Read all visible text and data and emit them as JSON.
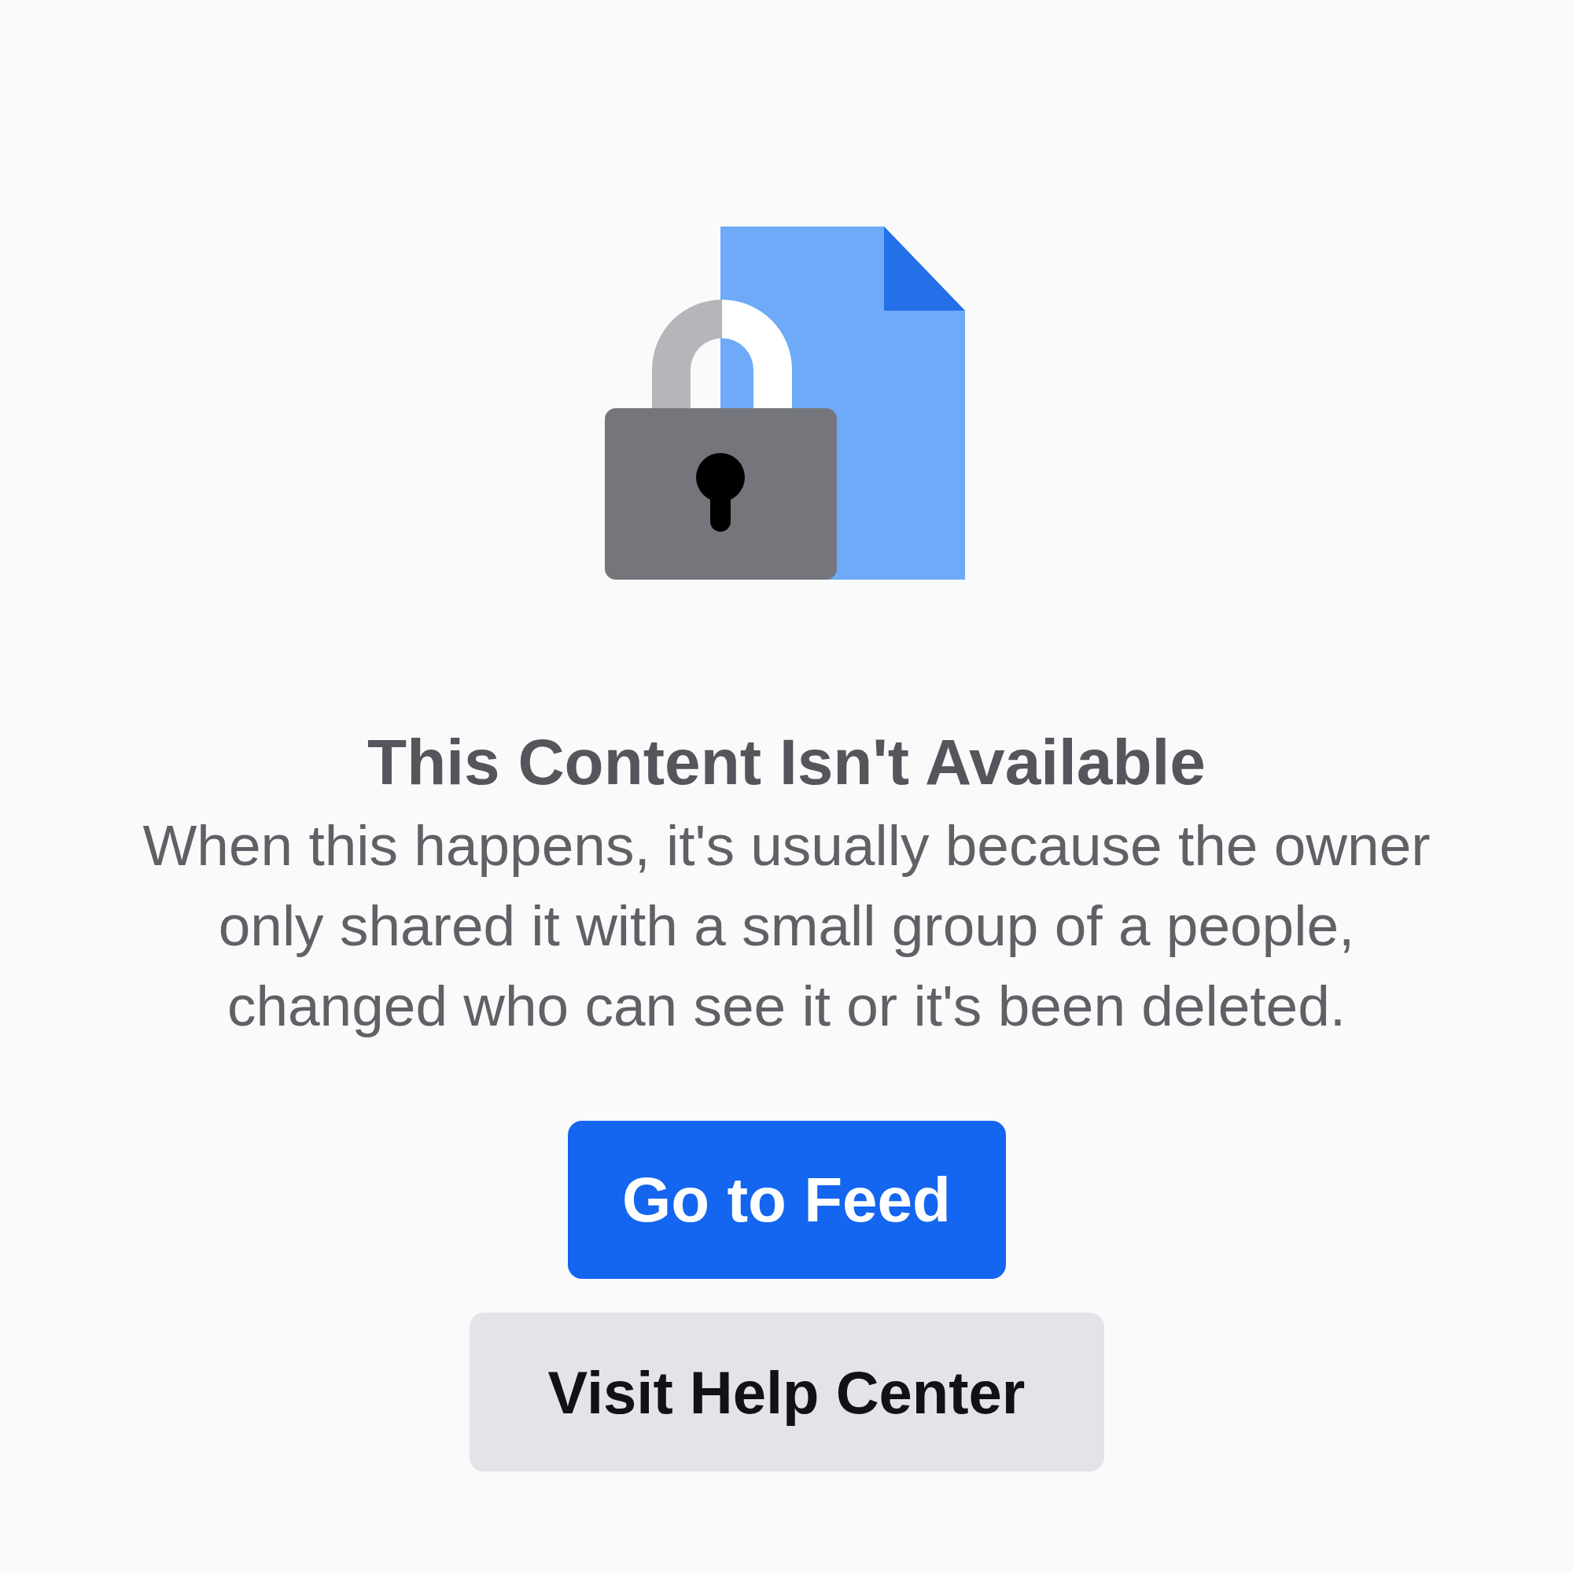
{
  "title": "This Content Isn't Available",
  "message": "When this happens, it's usually because the owner only shared it with a small group of a people, changed who can see it or it's been deleted.",
  "buttons": [
    {
      "label": "Go to Feed",
      "kind": "primary"
    },
    {
      "label": "Visit Help Center",
      "kind": "secondary"
    }
  ]
}
